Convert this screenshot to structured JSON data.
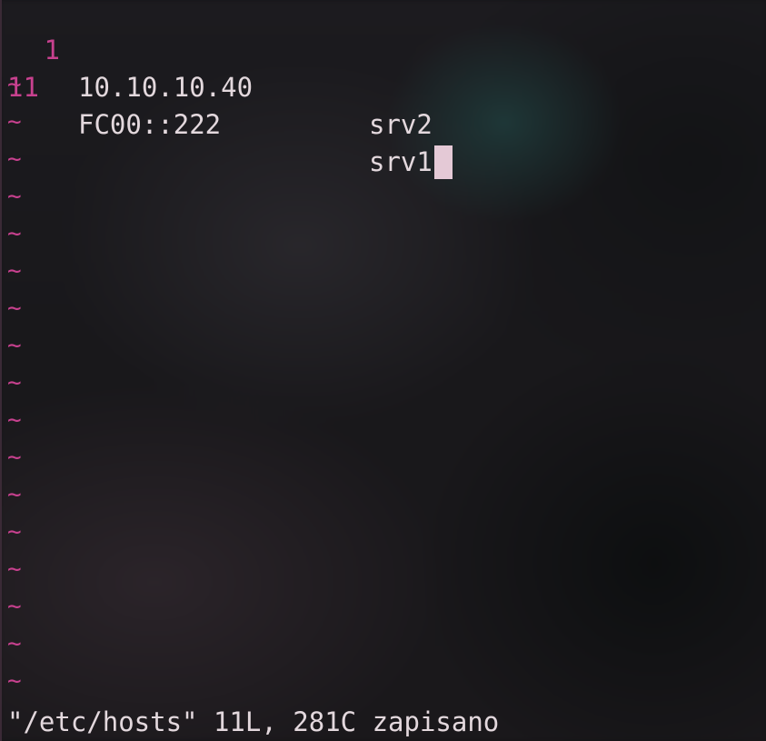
{
  "editor": {
    "lines": [
      {
        "number": "1",
        "ip": "10.10.10.40",
        "host": "srv2"
      },
      {
        "number": "11",
        "ip": "FC00::222",
        "host": "srv1"
      }
    ],
    "tilde": "~"
  },
  "status": {
    "message": "\"/etc/hosts\" 11L, 281C zapisano"
  },
  "colors": {
    "line_number": "#c8418f",
    "text": "#e3d8dd",
    "cursor": "#e4c9d6",
    "background": "#151417"
  }
}
